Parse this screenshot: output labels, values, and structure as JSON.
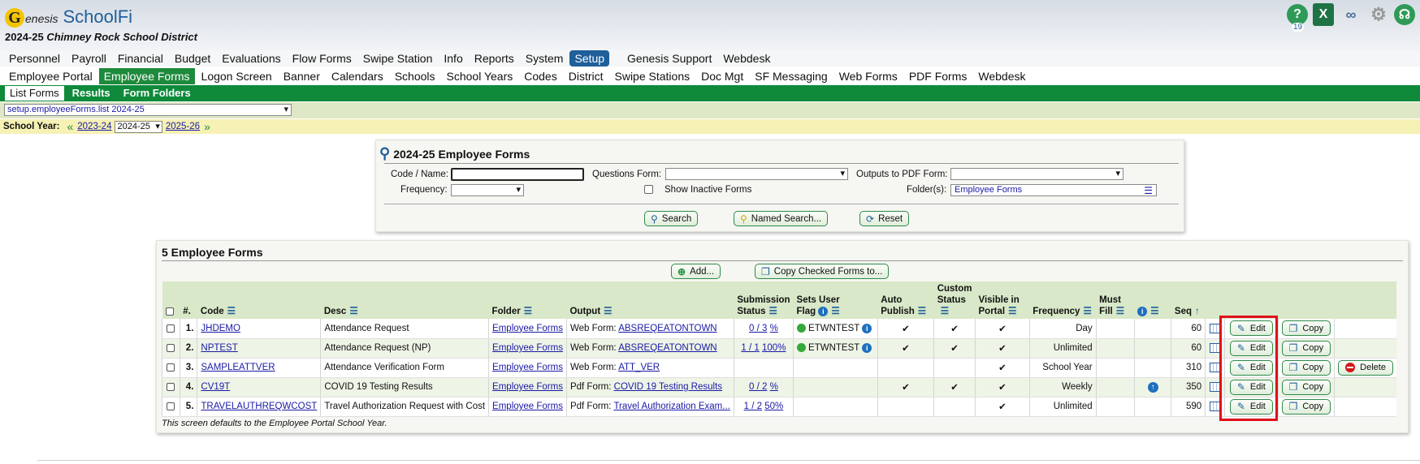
{
  "app": {
    "brand_letter": "G",
    "brand_small": "enesis",
    "brand_product": "SchoolFi",
    "district_year": "2024-25",
    "district_name": "Chimney Rock School District",
    "notification_count": "19",
    "excel_label": "X"
  },
  "menu1": [
    "Personnel",
    "Payroll",
    "Financial",
    "Budget",
    "Evaluations",
    "Flow Forms",
    "Swipe Station",
    "Info",
    "Reports",
    "System",
    "Setup",
    "Genesis Support",
    "Webdesk"
  ],
  "menu2": [
    "Employee Portal",
    "Employee Forms",
    "Logon Screen",
    "Banner",
    "Calendars",
    "Schools",
    "School Years",
    "Codes",
    "District",
    "Swipe Stations",
    "Doc Mgt",
    "SF Messaging",
    "Web Forms",
    "PDF Forms",
    "Webdesk"
  ],
  "menu3": [
    "List Forms",
    "Results",
    "Form Folders"
  ],
  "screen_select": "setup.employeeForms.list 2024-25",
  "yearbar": {
    "label": "School Year:",
    "prev": "2023-24",
    "current": "2024-25",
    "next": "2025-26"
  },
  "search": {
    "title": "2024-25 Employee Forms",
    "code_label": "Code / Name:",
    "code_value": "",
    "questions_label": "Questions Form:",
    "questions_value": "",
    "outputs_label": "Outputs to PDF Form:",
    "outputs_value": "",
    "frequency_label": "Frequency:",
    "frequency_value": "",
    "inactive_label": "Show Inactive Forms",
    "folders_label": "Folder(s):",
    "folders_value": "Employee Forms",
    "search_btn": "Search",
    "named_btn": "Named Search...",
    "reset_btn": "Reset"
  },
  "forms": {
    "title": "5 Employee Forms",
    "add_btn": "Add...",
    "copy_checked_btn": "Copy Checked Forms to...",
    "headers": {
      "num": "#.",
      "code": "Code",
      "desc": "Desc",
      "folder": "Folder",
      "output": "Output",
      "sub1": "Submission",
      "sub2": "Status",
      "flag1": "Sets User",
      "flag2": "Flag",
      "auto1": "Auto",
      "auto2": "Publish",
      "cust1": "Custom",
      "cust2": "Status",
      "vis1": "Visible in",
      "vis2": "Portal",
      "freq": "Frequency",
      "must1": "Must",
      "must2": "Fill",
      "seq": "Seq"
    },
    "rows": [
      {
        "num": "1.",
        "code": "JHDEMO",
        "desc": "Attendance Request",
        "folder": "Employee Forms",
        "out_type": "Web Form:",
        "out_link": "ABSREQEATONTOWN",
        "sub": "0 / 3",
        "pct": "%",
        "flag": "ETWNTEST",
        "auto": "✔",
        "cust": "✔",
        "vis": "✔",
        "freq": "Day",
        "up": "",
        "seq": "60",
        "edit": "Edit",
        "copy": "Copy",
        "del": ""
      },
      {
        "num": "2.",
        "code": "NPTEST",
        "desc": "Attendance Request (NP)",
        "folder": "Employee Forms",
        "out_type": "Web Form:",
        "out_link": "ABSREQEATONTOWN",
        "sub": "1 / 1",
        "pct": "100%",
        "flag": "ETWNTEST",
        "auto": "✔",
        "cust": "✔",
        "vis": "✔",
        "freq": "Unlimited",
        "up": "",
        "seq": "60",
        "edit": "Edit",
        "copy": "Copy",
        "del": ""
      },
      {
        "num": "3.",
        "code": "SAMPLEATTVER",
        "desc": "Attendance Verification Form",
        "folder": "Employee Forms",
        "out_type": "Web Form:",
        "out_link": "ATT_VER",
        "sub": "",
        "pct": "",
        "flag": "",
        "auto": "",
        "cust": "",
        "vis": "✔",
        "freq": "School Year",
        "up": "",
        "seq": "310",
        "edit": "Edit",
        "copy": "Copy",
        "del": "Delete"
      },
      {
        "num": "4.",
        "code": "CV19T",
        "desc": "COVID 19 Testing Results",
        "folder": "Employee Forms",
        "out_type": "Pdf Form:",
        "out_link": "COVID 19 Testing Results",
        "sub": "0 / 2",
        "pct": "%",
        "flag": "",
        "auto": "✔",
        "cust": "✔",
        "vis": "✔",
        "freq": "Weekly",
        "up": "↑",
        "seq": "350",
        "edit": "Edit",
        "copy": "Copy",
        "del": ""
      },
      {
        "num": "5.",
        "code": "TRAVELAUTHREQWCOST",
        "desc": "Travel Authorization Request with Cost",
        "folder": "Employee Forms",
        "out_type": "Pdf Form:",
        "out_link": "Travel Authorization Exam...",
        "sub": "1 / 2",
        "pct": "50%",
        "flag": "",
        "auto": "",
        "cust": "",
        "vis": "✔",
        "freq": "Unlimited",
        "up": "",
        "seq": "590",
        "edit": "Edit",
        "copy": "Copy",
        "del": ""
      }
    ],
    "footnote": "This screen defaults to the Employee Portal School Year."
  },
  "colors": {
    "green": "#0e8a3a",
    "blue": "#1f5f9a",
    "highlight": "#e0101a"
  }
}
